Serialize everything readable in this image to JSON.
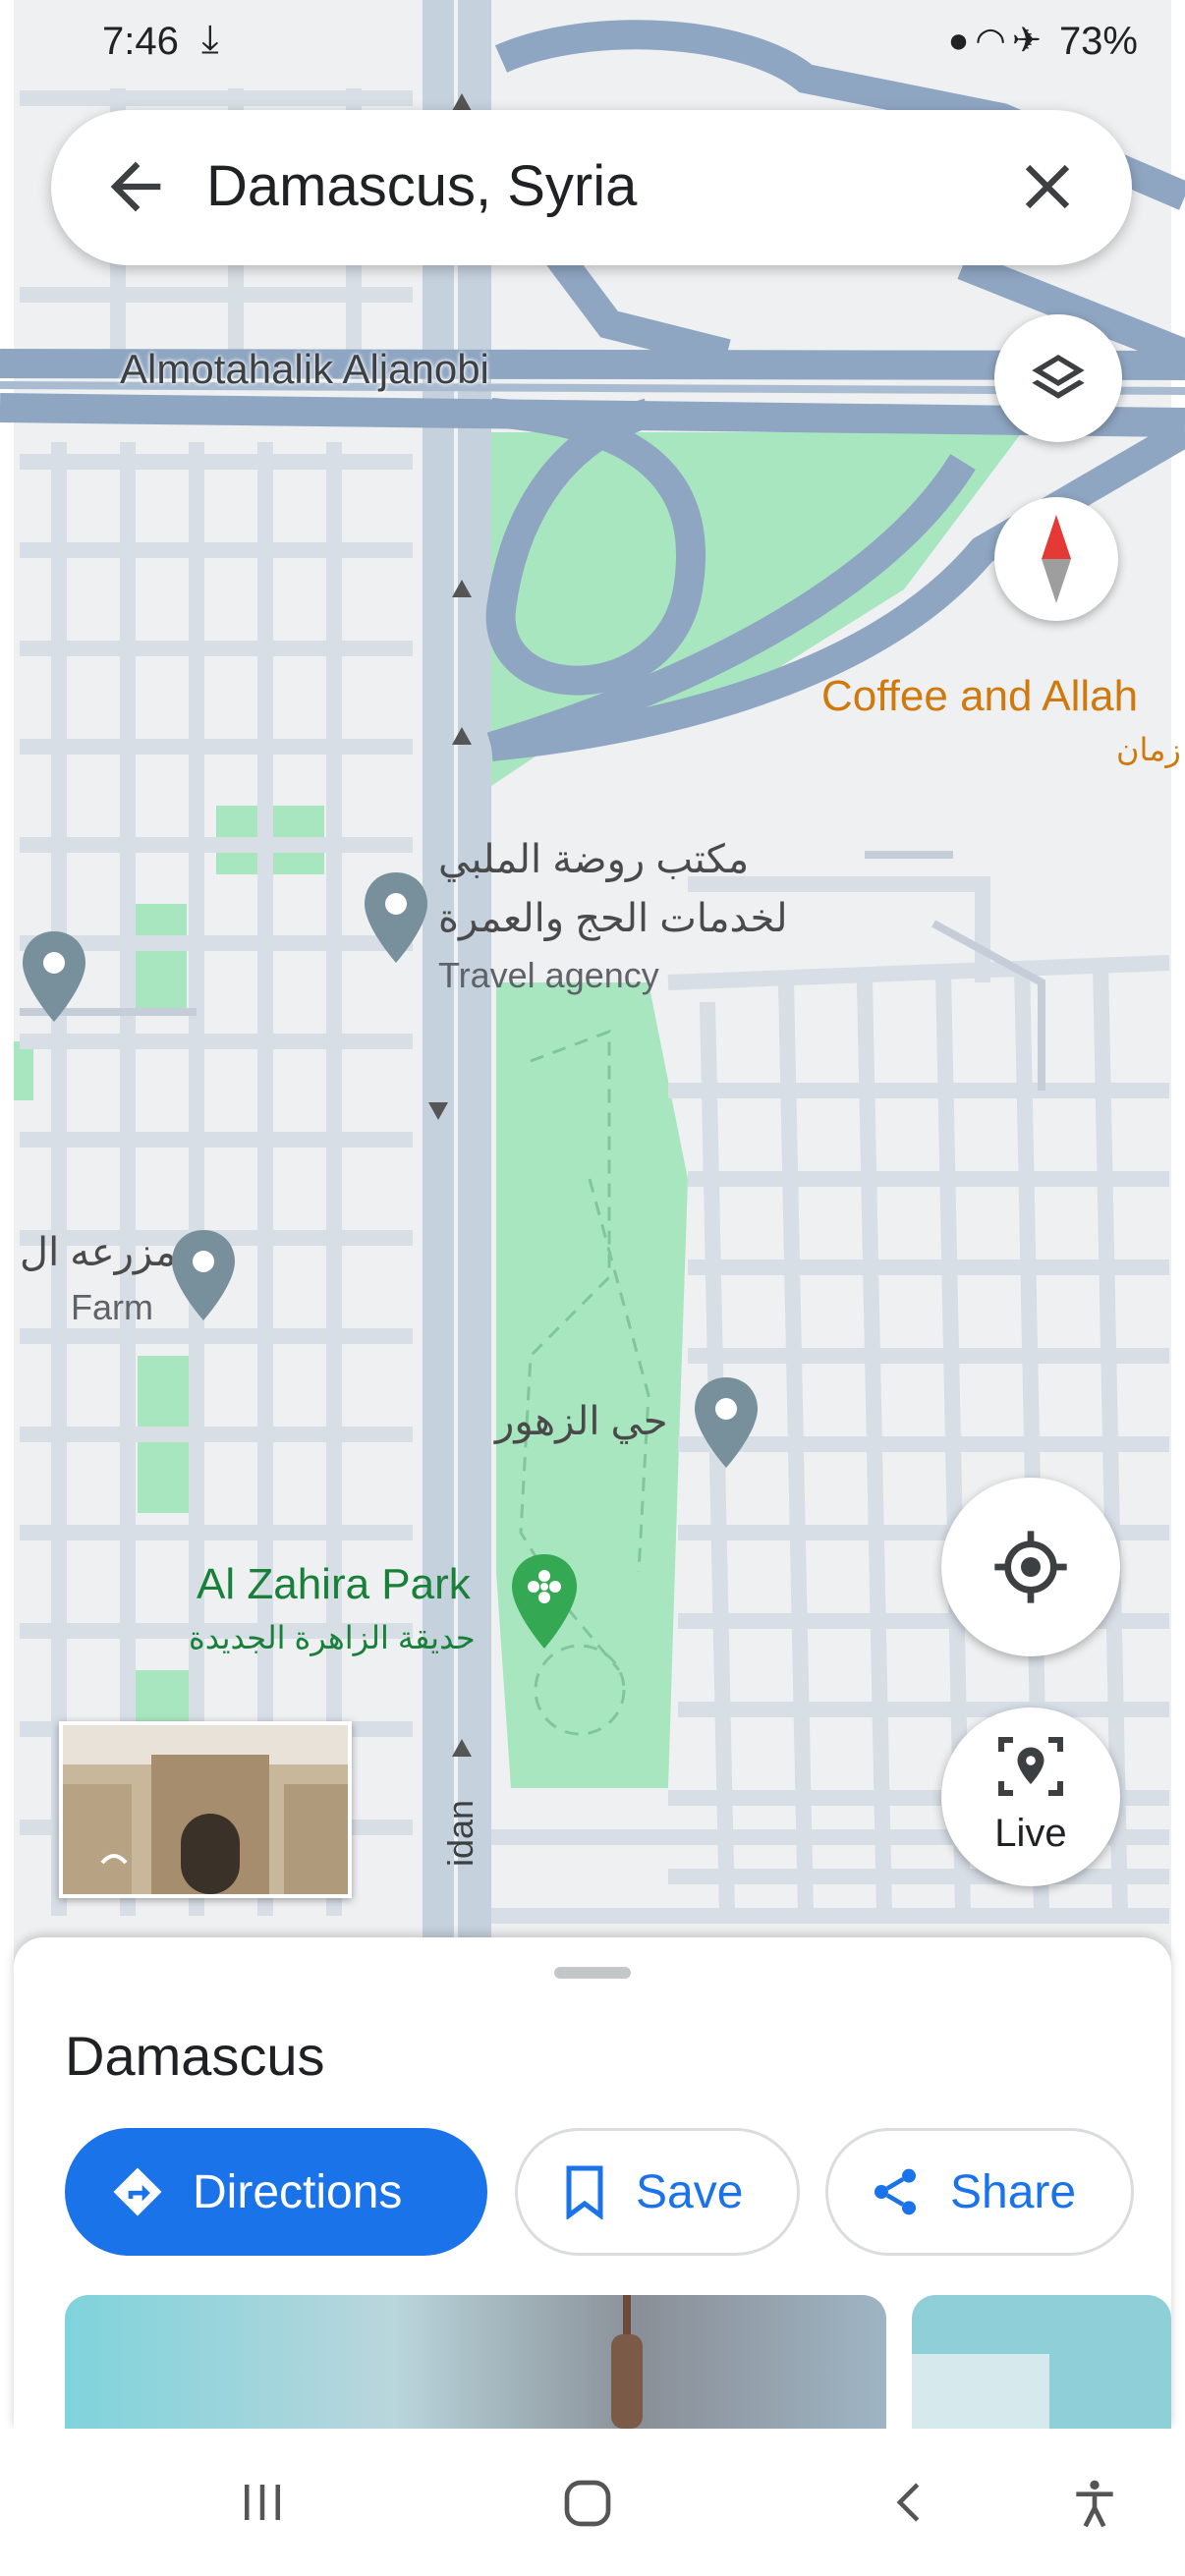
{
  "status_bar": {
    "time": "7:46",
    "battery": "73%"
  },
  "search": {
    "query": "Damascus, Syria"
  },
  "map": {
    "road_label": "Almotahalik Aljanobi",
    "street_label_vertical": "idan",
    "places": [
      {
        "name": "Coffee and Allah",
        "subtitle": "زمان"
      },
      {
        "name": "مكتب روضة الملبي",
        "line2": "لخدمات الحج والعمرة",
        "category": "Travel agency"
      },
      {
        "name": "مزرعه ال",
        "category": "Farm"
      },
      {
        "name": "حي الزهور"
      },
      {
        "name": "Al Zahira Park",
        "subtitle": "حديقة الزاهرة الجديدة"
      }
    ],
    "live_label": "Live"
  },
  "sheet": {
    "title": "Damascus",
    "directions_label": "Directions",
    "save_label": "Save",
    "share_label": "Share"
  },
  "colors": {
    "accent": "#1a73e8",
    "park": "#a8e6c0",
    "road": "#8fa6c3",
    "poi_coffee": "#d07a0e",
    "poi_park": "#188038"
  }
}
